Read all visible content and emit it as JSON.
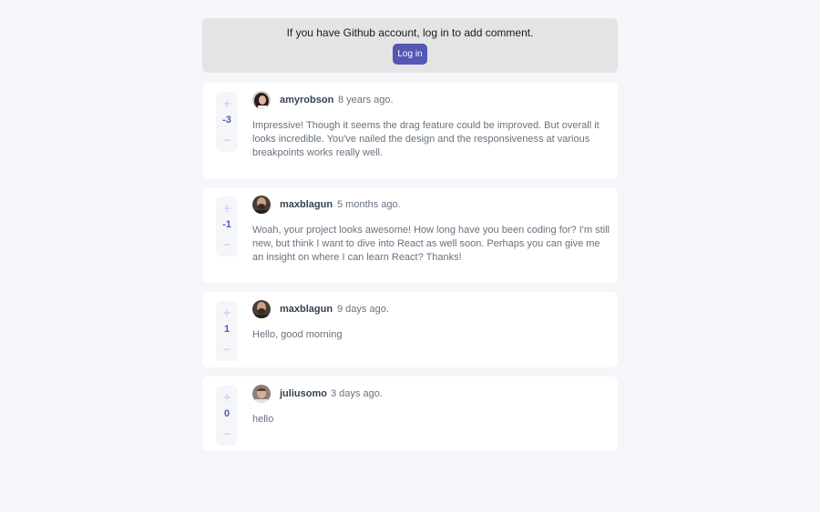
{
  "login_banner": {
    "message": "If you have Github account, log in to add comment.",
    "button_label": "Log in"
  },
  "vote_controls": {
    "plus": "+",
    "minus": "−"
  },
  "comments": [
    {
      "username": "amyrobson",
      "timestamp": "8 years ago.",
      "score": "-3",
      "content": "Impressive! Though it seems the drag feature could be improved. But overall it looks incredible. You've nailed the design and the responsiveness at various breakpoints works really well."
    },
    {
      "username": "maxblagun",
      "timestamp": "5 months ago.",
      "score": "-1",
      "content": "Woah, your project looks awesome! How long have you been coding for? I'm still new, but think I want to dive into React as well soon. Perhaps you can give me an insight on where I can learn React? Thanks!"
    },
    {
      "username": "maxblagun",
      "timestamp": "9 days ago.",
      "score": "1",
      "content": "Hello, good morning"
    },
    {
      "username": "juliusomo",
      "timestamp": "3 days ago.",
      "score": "0",
      "content": "hello"
    }
  ],
  "colors": {
    "page_background": "#f5f6fa",
    "banner_background": "#e4e4e4",
    "accent": "#5457b6",
    "accent_light": "#c5c6ef",
    "username": "#334253",
    "body_text": "#67727e"
  }
}
